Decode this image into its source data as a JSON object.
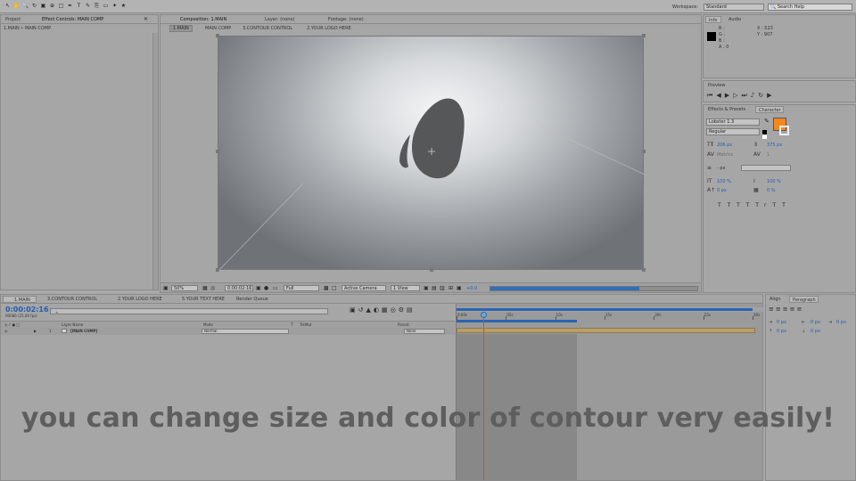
{
  "toolbar": {
    "workspace_label": "Workspace:",
    "workspace_value": "Standard",
    "search_placeholder": "Search Help"
  },
  "left_panel": {
    "tab_project": "Project",
    "tab_effect_controls": "Effect Controls: MAIN COMP",
    "breadcrumb": "1.MAIN • MAIN COMP"
  },
  "viewer": {
    "tab_composition": "Composition: 1.MAIN",
    "tab_layer": "Layer: (none)",
    "tab_footage": "Footage: (none)",
    "flow": [
      "1.MAIN",
      "MAIN COMP",
      "3.CONTOUR CONTROL",
      "2.YOUR LOGO HERE"
    ],
    "zoom": "50%",
    "timecode": "0:00:02:16",
    "resolution": "Full",
    "camera": "Active Camera",
    "view": "1 View",
    "exposure": "+0.0",
    "render_progress": 0.72
  },
  "info": {
    "tab_info": "Info",
    "tab_audio": "Audio",
    "r": "R :",
    "g": "G :",
    "b": "B :",
    "a": "A : 0",
    "x": "X : 523",
    "y": "Y : 907"
  },
  "preview": {
    "tab": "Preview"
  },
  "character": {
    "tab_effects": "Effects & Presets",
    "tab_character": "Character",
    "font": "Lobster 1.3",
    "style": "Regular",
    "size": "206 px",
    "leading": "375 px",
    "kerning": "Metrics",
    "tracking": "1",
    "stroke_width": "- px",
    "vscale": "100 %",
    "hscale": "100 %",
    "baseline": "0 px",
    "tsume": "0 %",
    "fill_color": "#f7861c",
    "text_buttons": [
      "T",
      "T",
      "TT",
      "Tr",
      "T",
      "T"
    ]
  },
  "timeline": {
    "tabs": [
      "1.MAIN",
      "3.CONTOUR CONTROL",
      "2.YOUR LOGO HERE",
      "5.YOUR TEXT HERE",
      "Render Queue"
    ],
    "timecode": "0:00:02:16",
    "frame_info": "00066 (25.00 fps)",
    "col_layer_name": "Layer Name",
    "col_mode": "Mode",
    "col_t": "T",
    "col_trkmat": "TrkMat",
    "col_parent": "Parent",
    "ruler": [
      "0:00s",
      "05s",
      "10s",
      "15s",
      "20s",
      "25s",
      "30s"
    ],
    "layer_index": "1",
    "layer_name": "[MAIN COMP]",
    "layer_mode": "Normal",
    "layer_parent": "None"
  },
  "align": {
    "tab_align": "Align",
    "tab_paragraph": "Paragraph",
    "indent_values": [
      "0 px",
      "0 px",
      "0 px",
      "0 px",
      "0 px"
    ]
  },
  "caption": "you can change size and color of contour very easily!"
}
